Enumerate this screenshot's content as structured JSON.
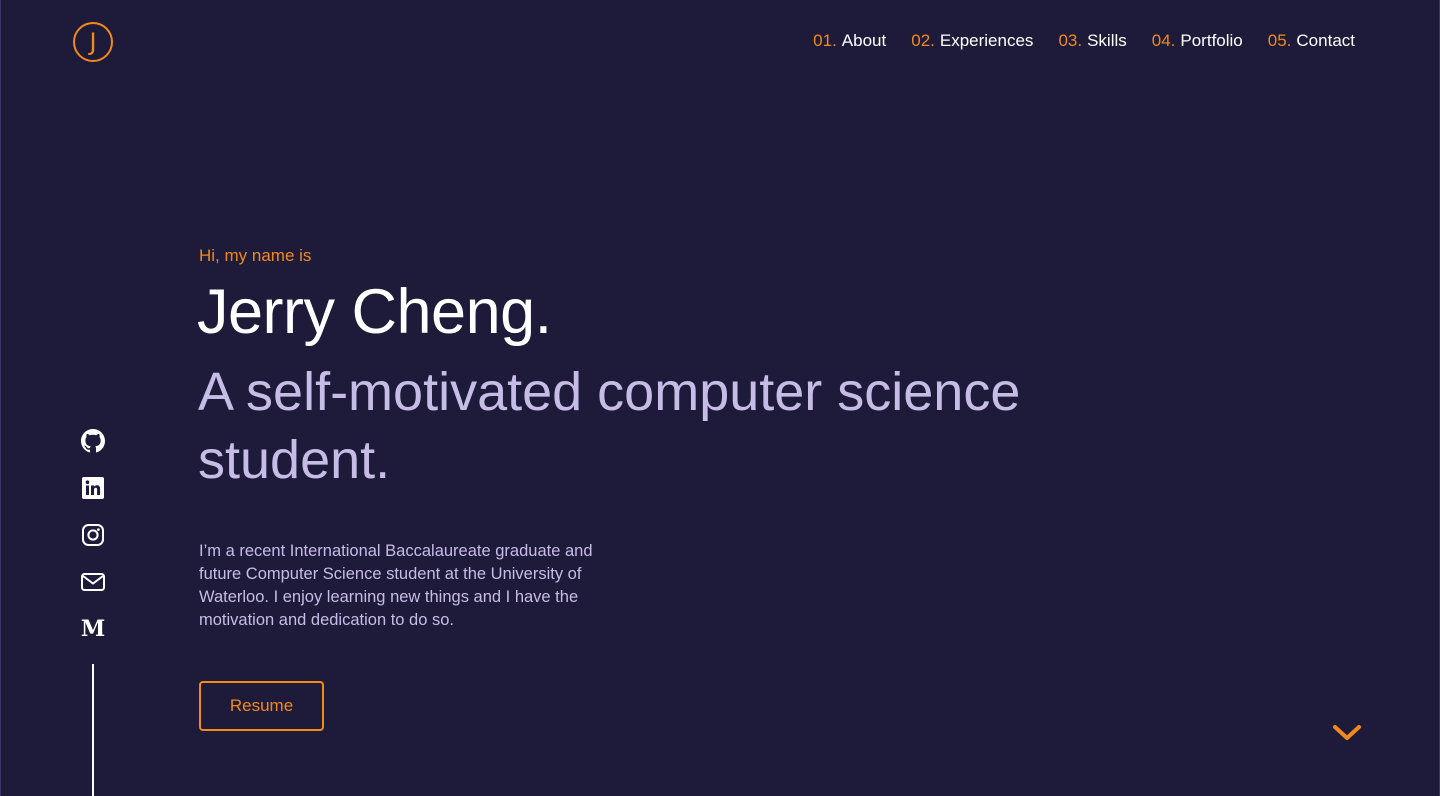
{
  "logo": {
    "letter": "J",
    "icon": "j-monogram-logo"
  },
  "nav": [
    {
      "num": "01.",
      "label": "About"
    },
    {
      "num": "02.",
      "label": "Experiences"
    },
    {
      "num": "03.",
      "label": "Skills"
    },
    {
      "num": "04.",
      "label": "Portfolio"
    },
    {
      "num": "05.",
      "label": "Contact"
    }
  ],
  "socials": [
    {
      "icon": "github-icon"
    },
    {
      "icon": "linkedin-icon"
    },
    {
      "icon": "instagram-icon"
    },
    {
      "icon": "mail-icon"
    },
    {
      "icon": "medium-icon",
      "glyph": "M"
    }
  ],
  "hero": {
    "greeting": "Hi, my name is",
    "name": "Jerry Cheng.",
    "tagline": "A self-motivated computer science student.",
    "bio": "I’m a recent International Baccalaureate graduate and future Computer Science student at the University of Waterloo. I enjoy learning new things and I have the motivation and dedication to do so.",
    "resume_label": "Resume"
  },
  "scroll_icon": "chevron-down-icon",
  "colors": {
    "background": "#1e1a39",
    "accent": "#f28a1a",
    "heading": "#ffffff",
    "muted": "#c6bde6"
  }
}
